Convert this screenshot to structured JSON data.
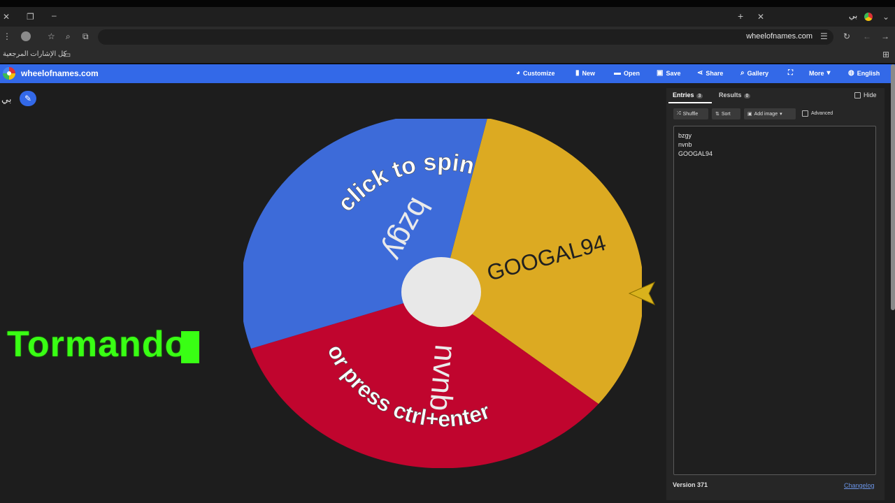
{
  "browser": {
    "tab_title": "بي",
    "url": "wheelofnames.com",
    "bookmarks_label": "كل الإشارات المرجعية"
  },
  "app": {
    "site_title": "wheelofnames.com",
    "menu": [
      {
        "label": "Customize",
        "icon": "palette-icon"
      },
      {
        "label": "New",
        "icon": "file-icon"
      },
      {
        "label": "Open",
        "icon": "folder-icon"
      },
      {
        "label": "Save",
        "icon": "save-icon"
      },
      {
        "label": "Share",
        "icon": "share-icon"
      },
      {
        "label": "Gallery",
        "icon": "search-icon"
      },
      {
        "label": "",
        "icon": "fullscreen-icon"
      },
      {
        "label": "More",
        "icon": "chevron-down-icon"
      },
      {
        "label": "English",
        "icon": "globe-icon"
      }
    ],
    "accent_color": "#3369e8"
  },
  "wheel": {
    "title": "بي",
    "prompt_top": "click to spin",
    "prompt_bottom": "or press ctrl+enter",
    "segments": [
      {
        "name": "bzgy",
        "color": "#3d6bd9"
      },
      {
        "name": "GOOGAL94",
        "color": "#dcaa22"
      },
      {
        "name": "nvnb",
        "color": "#c0052e"
      }
    ]
  },
  "overlay": {
    "text": "Tormando",
    "color": "#39ff14"
  },
  "panel": {
    "tabs": {
      "entries": "Entries",
      "entries_count": "3",
      "results": "Results",
      "results_count": "0"
    },
    "hide_label": "Hide",
    "shuffle_label": "Shuffle",
    "sort_label": "Sort",
    "add_image_label": "Add image",
    "advanced_label": "Advanced",
    "entries": [
      "bzgy",
      "nvnb",
      "GOOGAL94"
    ],
    "version": "Version 371",
    "changelog": "Changelog"
  }
}
